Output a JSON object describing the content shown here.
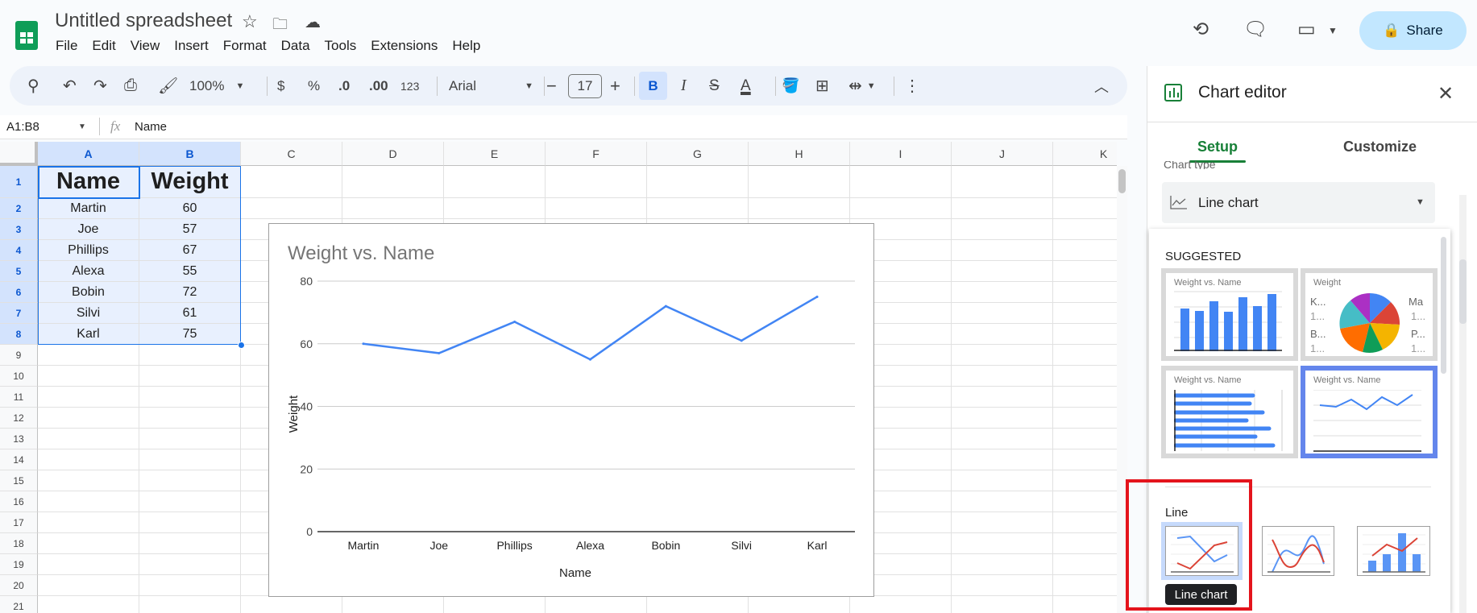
{
  "app": {
    "title": "Untitled spreadsheet",
    "menu": [
      "File",
      "Edit",
      "View",
      "Insert",
      "Format",
      "Data",
      "Tools",
      "Extensions",
      "Help"
    ],
    "share_label": "Share"
  },
  "toolbar": {
    "zoom": "100%",
    "currency": "$",
    "percent": "%",
    "dec_decrease": ".0",
    "dec_increase": ".00",
    "format_123": "123",
    "font": "Arial",
    "font_size": "17",
    "bold": "B",
    "italic": "I",
    "text_color_letter": "A"
  },
  "formula_bar": {
    "name_box": "A1:B8",
    "fx": "fx",
    "value": "Name"
  },
  "sheet": {
    "columns": [
      "A",
      "B",
      "C",
      "D",
      "E",
      "F",
      "G",
      "H",
      "I",
      "J",
      "K"
    ],
    "rows": [
      "1",
      "2",
      "3",
      "4",
      "5",
      "6",
      "7",
      "8",
      "9",
      "10",
      "11",
      "12",
      "13",
      "14",
      "15",
      "16",
      "17",
      "18",
      "19",
      "20",
      "21"
    ],
    "data": [
      [
        "Name",
        "Weight"
      ],
      [
        "Martin",
        "60"
      ],
      [
        "Joe",
        "57"
      ],
      [
        "Phillips",
        "67"
      ],
      [
        "Alexa",
        "55"
      ],
      [
        "Bobin",
        "72"
      ],
      [
        "Silvi",
        "61"
      ],
      [
        "Karl",
        "75"
      ]
    ]
  },
  "chart_data": {
    "type": "line",
    "title": "Weight vs. Name",
    "xlabel": "Name",
    "ylabel": "Weight",
    "categories": [
      "Martin",
      "Joe",
      "Phillips",
      "Alexa",
      "Bobin",
      "Silvi",
      "Karl"
    ],
    "series": [
      {
        "name": "Weight",
        "values": [
          60,
          57,
          67,
          55,
          72,
          61,
          75
        ],
        "color": "#4285f4"
      }
    ],
    "ylim": [
      0,
      80
    ],
    "yticks": [
      "0",
      "20",
      "40",
      "60",
      "80"
    ],
    "grid": true
  },
  "editor": {
    "title": "Chart editor",
    "tabs": [
      "Setup",
      "Customize"
    ],
    "chart_type_label": "Chart type",
    "chart_type_value": "Line chart",
    "suggested_label": "SUGGESTED",
    "suggested": [
      {
        "title": "Weight vs. Name"
      },
      {
        "title": "Weight",
        "pie_labels": [
          "K...",
          "1...",
          "B...",
          "1...",
          "Ma",
          "1...",
          "P...",
          "1..."
        ]
      },
      {
        "title": "Weight vs. Name"
      },
      {
        "title": "Weight vs. Name"
      }
    ],
    "line_section": "Line",
    "tooltip": "Line chart",
    "accent": "#188038",
    "highlight": "#e4141c"
  }
}
